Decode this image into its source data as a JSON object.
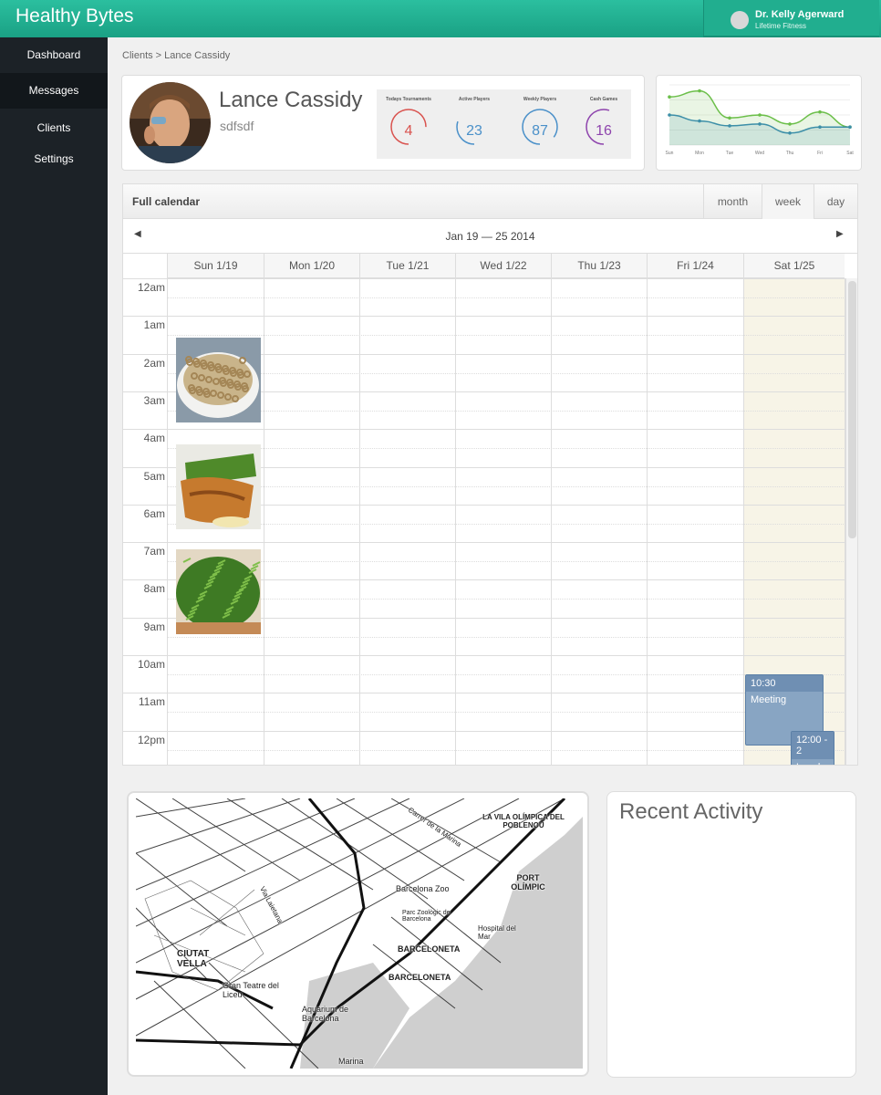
{
  "app": {
    "title": "Healthy Bytes"
  },
  "user": {
    "name": "Dr. Kelly Agerward",
    "org": "Lifetime Fitness"
  },
  "sidebar": {
    "items": [
      {
        "label": "Dashboard"
      },
      {
        "label": "Messages"
      },
      {
        "label": "Clients"
      },
      {
        "label": "Settings"
      }
    ]
  },
  "breadcrumb": {
    "text": "Clients > Lance Cassidy"
  },
  "profile": {
    "name": "Lance Cassidy",
    "subtitle": "sdfsdf"
  },
  "stats": [
    {
      "label": "Todays Tournaments",
      "value": "4",
      "color": "#d9534f",
      "fraction": 0.75
    },
    {
      "label": "Active Players",
      "value": "23",
      "color": "#4a90c9",
      "fraction": 0.3
    },
    {
      "label": "Weekly Players",
      "value": "87",
      "color": "#4a90c9",
      "fraction": 0.85
    },
    {
      "label": "Cash Games",
      "value": "16",
      "color": "#8e44ad",
      "fraction": 0.55
    }
  ],
  "chart_data": {
    "type": "line",
    "categories": [
      "Sun",
      "Mon",
      "Tue",
      "Wed",
      "Thu",
      "Fri",
      "Sat"
    ],
    "series": [
      {
        "values": [
          0.8,
          0.9,
          0.45,
          0.5,
          0.35,
          0.55,
          0.3
        ],
        "color": "#6cbf4a"
      },
      {
        "values": [
          0.5,
          0.4,
          0.32,
          0.35,
          0.2,
          0.3,
          0.3
        ],
        "color": "#3d8fa8"
      }
    ],
    "ylim": [
      0,
      1
    ]
  },
  "calendar": {
    "title": "Full calendar",
    "views": [
      "month",
      "week",
      "day"
    ],
    "active_view": "week",
    "range": "Jan 19 — 25 2014",
    "prev": "◀",
    "next": "▶",
    "days": [
      "Sun 1/19",
      "Mon 1/20",
      "Tue 1/21",
      "Wed 1/22",
      "Thu 1/23",
      "Fri 1/24",
      "Sat 1/25"
    ],
    "hours": [
      "12am",
      "1am",
      "2am",
      "3am",
      "4am",
      "5am",
      "6am",
      "7am",
      "8am",
      "9am",
      "10am",
      "11am",
      "12pm"
    ],
    "events": [
      {
        "time": "10:30",
        "title": "Meeting"
      },
      {
        "time": "12:00 - 2",
        "title": "Lunch"
      }
    ]
  },
  "map": {
    "labels": [
      "LA VILA OLÍMPICA DEL POBLENOU",
      "PORT OLÍMPIC",
      "Barcelona Zoo",
      "Parc Zoològic de Barcelona",
      "Hospital del Mar",
      "BARCELONETA",
      "BARCELONETA",
      "CIUTAT VELLA",
      "Gran Teatre del Liceu",
      "Aquarium de Barcelona",
      "Marina",
      "Via Laietana",
      "Carrer de la Marina"
    ]
  },
  "activity": {
    "title": "Recent Activity"
  }
}
